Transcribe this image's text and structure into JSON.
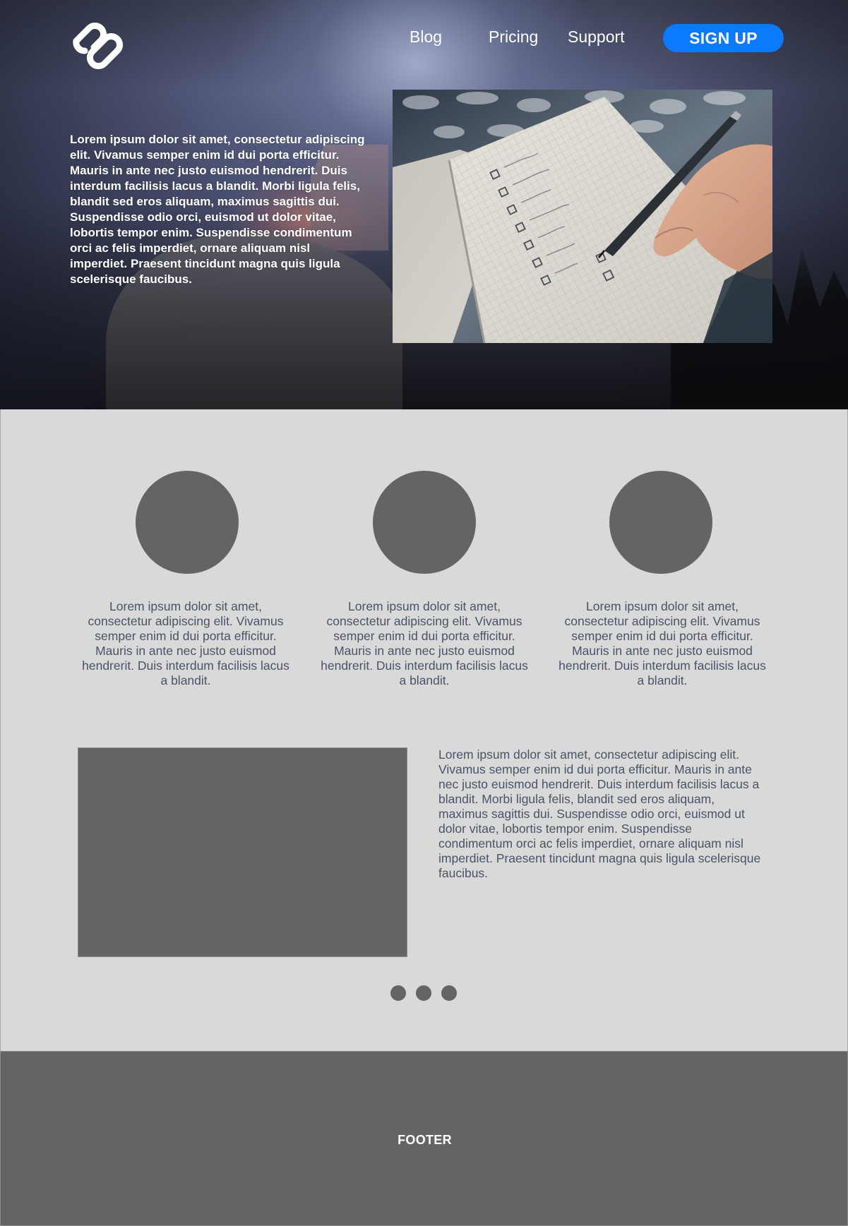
{
  "header": {
    "logo_icon": "link-chain-logo",
    "nav": [
      {
        "label": "Blog"
      },
      {
        "label": "Pricing"
      },
      {
        "label": "Support"
      }
    ],
    "signup_label": "SIGN UP",
    "signup_color": "#0a7bff"
  },
  "hero": {
    "text": "Lorem ipsum dolor sit amet, consectetur adipiscing elit. Vivamus semper enim id dui porta efficitur. Mauris in ante nec justo euismod hendrerit. Duis interdum facilisis lacus a blandit. Morbi ligula felis, blandit sed eros aliquam, maximus sagittis dui. Suspendisse odio orci, euismod ut dolor vitae, lobortis tempor enim. Suspendisse condimentum orci ac felis imperdiet, ornare aliquam nisl imperdiet. Praesent tincidunt magna quis ligula scelerisque faucibus.",
    "photo": "notebook-checklist-photo"
  },
  "features": [
    {
      "text": "Lorem ipsum dolor sit amet, consectetur adipiscing elit. Vivamus semper enim id dui porta efficitur. Mauris in ante nec justo euismod hendrerit. Duis interdum facilisis lacus a blandit."
    },
    {
      "text": "Lorem ipsum dolor sit amet, consectetur adipiscing elit. Vivamus semper enim id dui porta efficitur. Mauris in ante nec justo euismod hendrerit. Duis interdum facilisis lacus a blandit."
    },
    {
      "text": "Lorem ipsum dolor sit amet, consectetur adipiscing elit. Vivamus semper enim id dui porta efficitur. Mauris in ante nec justo euismod hendrerit. Duis interdum facilisis lacus a blandit."
    }
  ],
  "media": {
    "text": "Lorem ipsum dolor sit amet, consectetur adipiscing elit. Vivamus semper enim id dui porta efficitur. Mauris in ante nec justo euismod hendrerit. Duis interdum facilisis lacus a blandit. Morbi ligula felis, blandit sed eros aliquam, maximus sagittis dui. Suspendisse odio orci, euismod ut dolor vitae, lobortis tempor enim. Suspendisse condimentum orci ac felis imperdiet, ornare aliquam nisl imperdiet. Praesent tincidunt magna quis ligula scelerisque faucibus."
  },
  "pagination": {
    "dot_count": 3
  },
  "footer": {
    "label": "FOOTER"
  },
  "colors": {
    "placeholder_gray": "#646464",
    "page_background": "#d9d9d9",
    "body_text": "#4a5365"
  }
}
